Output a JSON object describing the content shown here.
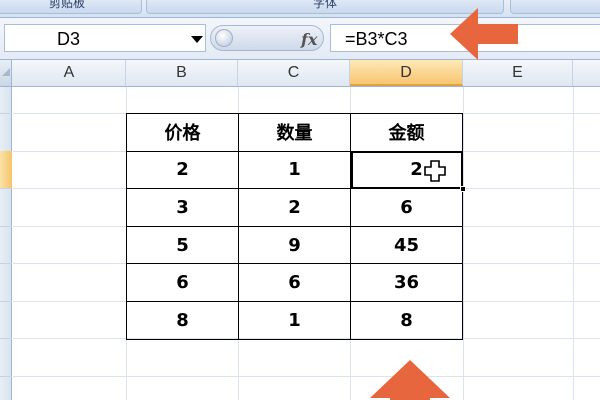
{
  "ribbon": {
    "groups": [
      "剪贴板",
      "字体"
    ]
  },
  "formula_bar": {
    "name_box": "D3",
    "fx_icon": "fx",
    "formula": "=B3*C3"
  },
  "columns": [
    "A",
    "B",
    "C",
    "D",
    "E"
  ],
  "active_column": "D",
  "table": {
    "headers": [
      "价格",
      "数量",
      "金额"
    ],
    "rows": [
      [
        "2",
        "1",
        "2"
      ],
      [
        "3",
        "2",
        "6"
      ],
      [
        "5",
        "9",
        "45"
      ],
      [
        "6",
        "6",
        "36"
      ],
      [
        "8",
        "1",
        "8"
      ]
    ],
    "selected_cell": "D3"
  },
  "colors": {
    "arrow": "#e8663d",
    "active_header": "#f8c66f"
  },
  "icons": [
    "dropdown-arrow-icon",
    "fx-icon",
    "move-cursor-icon",
    "right-arrow-icon",
    "up-arrow-icon"
  ]
}
